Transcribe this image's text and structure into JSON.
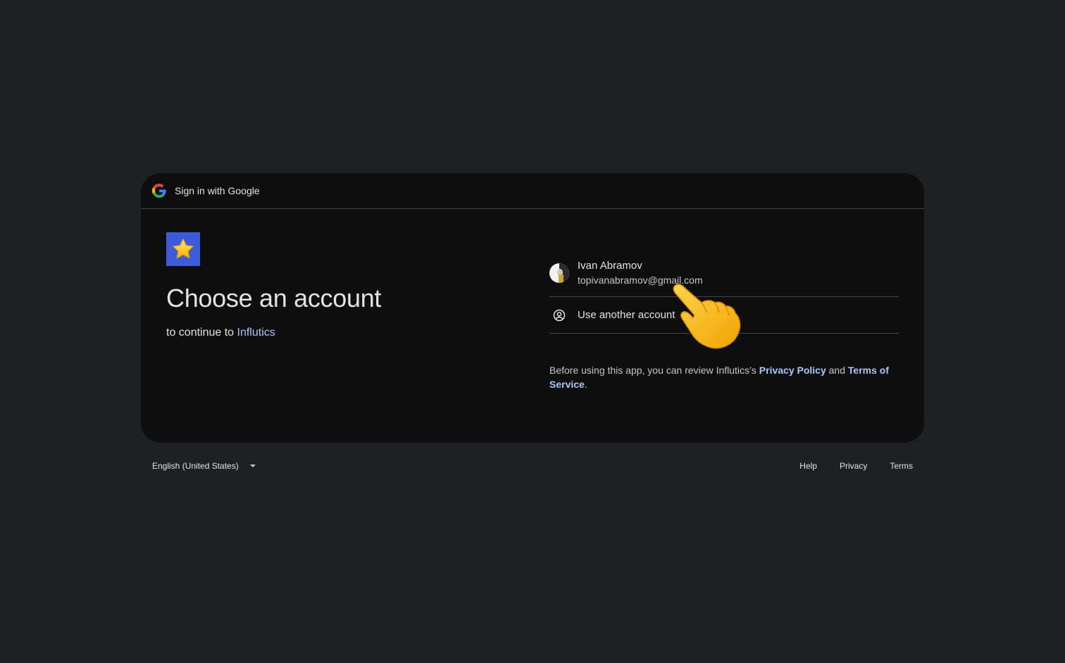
{
  "header": {
    "title": "Sign in with Google"
  },
  "main": {
    "title": "Choose an account",
    "subtitle_prefix": "to continue to ",
    "app_name": "Influtics"
  },
  "accounts": [
    {
      "name": "Ivan Abramov",
      "email": "topivanabramov@gmail.com"
    }
  ],
  "another_account_label": "Use another account",
  "policy": {
    "prefix": "Before using this app, you can review Influtics’s ",
    "privacy_link": "Privacy Policy",
    "and": " and ",
    "terms_link": "Terms of Service",
    "suffix": "."
  },
  "footer": {
    "language": "English (United States)",
    "help": "Help",
    "privacy": "Privacy",
    "terms": "Terms"
  },
  "colors": {
    "background": "#1f2023",
    "card": "#0e0e0e",
    "link": "#a8c7fa",
    "app_logo": "#3b5bdb"
  },
  "icons": {
    "google": "google-g-icon",
    "app": "star-icon",
    "person": "person-circle-icon",
    "pointer": "pointing-hand-icon",
    "dropdown": "caret-down-icon"
  }
}
